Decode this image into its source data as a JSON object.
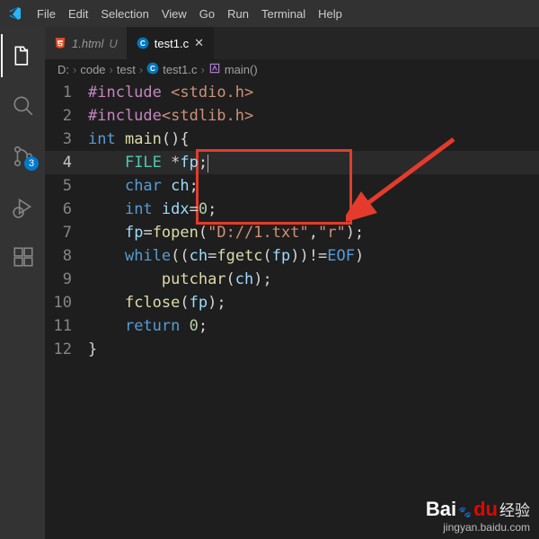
{
  "menubar": [
    "File",
    "Edit",
    "Selection",
    "View",
    "Go",
    "Run",
    "Terminal",
    "Help"
  ],
  "activity": {
    "badge": "3"
  },
  "tabs": [
    {
      "icon": "html5",
      "label": "1.html",
      "modified": "U",
      "active": false
    },
    {
      "icon": "c",
      "label": "test1.c",
      "active": true
    }
  ],
  "breadcrumb": {
    "parts": [
      "D:",
      "code",
      "test",
      "test1.c",
      "main()"
    ]
  },
  "code": {
    "lines": [
      {
        "n": "1",
        "html": "<span class='inc'>#include</span> <span class='str'>&lt;stdio.h&gt;</span>"
      },
      {
        "n": "2",
        "html": "<span class='inc'>#include</span><span class='str'>&lt;stdlib.h&gt;</span>"
      },
      {
        "n": "3",
        "html": "<span class='type'>int</span> <span class='fn'>main</span><span class='punc'>(){</span>"
      },
      {
        "n": "4",
        "cur": true,
        "html": "    <span class='typ2'>FILE</span> <span class='punc'>*</span><span class='var'>fp</span><span class='punc'>;</span><span class='cursor'></span>"
      },
      {
        "n": "5",
        "html": "    <span class='type'>char</span> <span class='var'>ch</span><span class='punc'>;</span>"
      },
      {
        "n": "6",
        "html": "    <span class='type'>int</span> <span class='var'>idx</span><span class='punc'>=</span><span class='num'>0</span><span class='punc'>;</span>"
      },
      {
        "n": "7",
        "html": "    <span class='var'>fp</span><span class='punc'>=</span><span class='fn'>fopen</span><span class='punc'>(</span><span class='str'>\"D://1.txt\"</span><span class='punc'>,</span><span class='str'>\"r\"</span><span class='punc'>);</span>"
      },
      {
        "n": "8",
        "html": "    <span class='kw'>while</span><span class='punc'>((</span><span class='var'>ch</span><span class='punc'>=</span><span class='fn'>fgetc</span><span class='punc'>(</span><span class='var'>fp</span><span class='punc'>))!=</span><span class='def'>EOF</span><span class='punc'>)</span>"
      },
      {
        "n": "9",
        "html": "        <span class='fn'>putchar</span><span class='punc'>(</span><span class='var'>ch</span><span class='punc'>);</span>"
      },
      {
        "n": "10",
        "html": "    <span class='fn'>fclose</span><span class='punc'>(</span><span class='var'>fp</span><span class='punc'>);</span>"
      },
      {
        "n": "11",
        "html": "    <span class='kw'>return</span> <span class='num'>0</span><span class='punc'>;</span>"
      },
      {
        "n": "12",
        "html": "<span class='punc'>}</span>"
      }
    ]
  },
  "watermark": {
    "brand": "Bai",
    "du": "du",
    "paw": "",
    "cn": "经验",
    "url": "jingyan.baidu.com"
  }
}
